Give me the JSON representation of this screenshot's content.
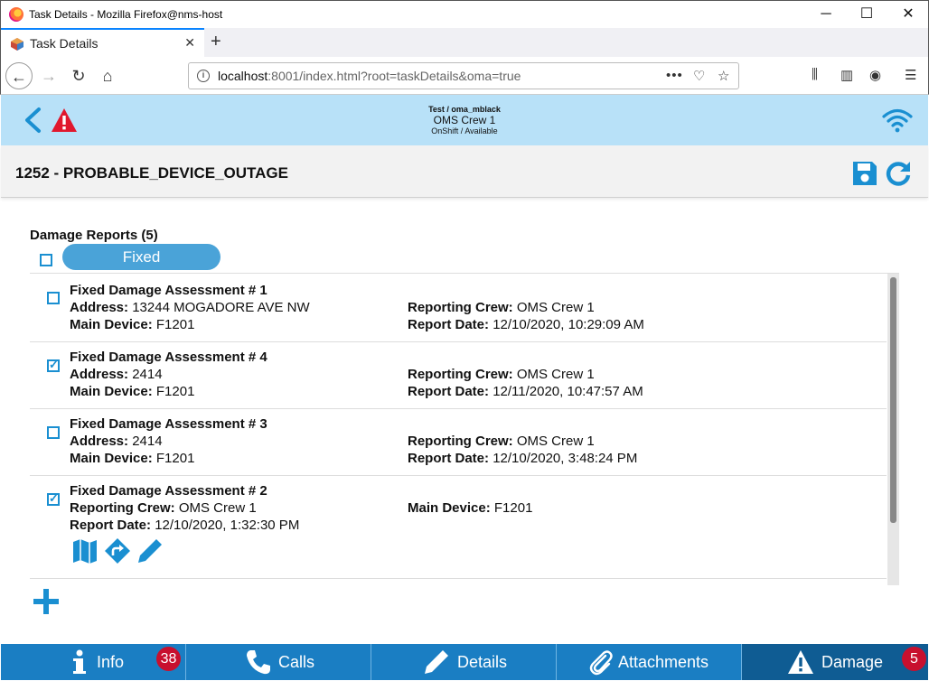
{
  "window": {
    "title": "Task Details - Mozilla Firefox@nms-host"
  },
  "browser": {
    "tab_title": "Task Details",
    "url_host": "localhost",
    "url_rest": ":8001/index.html?root=taskDetails&oma=true"
  },
  "header": {
    "user": "Test / oma_mblack",
    "crew": "OMS Crew 1",
    "status": "OnShift / Available"
  },
  "task": {
    "title": "1252 - PROBABLE_DEVICE_OUTAGE"
  },
  "damage": {
    "section_title": "Damage Reports (5)",
    "filter_label": "Fixed",
    "labels": {
      "address": "Address:",
      "main_device": "Main Device:",
      "reporting_crew": "Reporting Crew:",
      "report_date": "Report Date:"
    },
    "reports": [
      {
        "title": "Fixed Damage Assessment # 1",
        "checked": false,
        "address": "13244 MOGADORE AVE NW",
        "main_device": "F1201",
        "reporting_crew": "OMS Crew 1",
        "report_date": "12/10/2020, 10:29:09 AM"
      },
      {
        "title": "Fixed Damage Assessment # 4",
        "checked": true,
        "address": "2414",
        "main_device": "F1201",
        "reporting_crew": "OMS Crew 1",
        "report_date": "12/11/2020, 10:47:57 AM"
      },
      {
        "title": "Fixed Damage Assessment # 3",
        "checked": false,
        "address": "2414",
        "main_device": "F1201",
        "reporting_crew": "OMS Crew 1",
        "report_date": "12/10/2020, 3:48:24 PM"
      },
      {
        "title": "Fixed Damage Assessment # 2",
        "checked": true,
        "reporting_crew": "OMS Crew 1",
        "report_date": "12/10/2020, 1:32:30 PM",
        "main_device": "F1201"
      }
    ]
  },
  "bottom_tabs": [
    {
      "label": "Info",
      "badge": "38"
    },
    {
      "label": "Calls"
    },
    {
      "label": "Details"
    },
    {
      "label": "Attachments"
    },
    {
      "label": "Damage",
      "badge": "5",
      "active": true
    }
  ],
  "colors": {
    "accent": "#1a8fd1",
    "header_bg": "#b8e1f8",
    "bottom_bar": "#1a7ec3",
    "badge": "#c8102e",
    "warning": "#e0182d"
  }
}
